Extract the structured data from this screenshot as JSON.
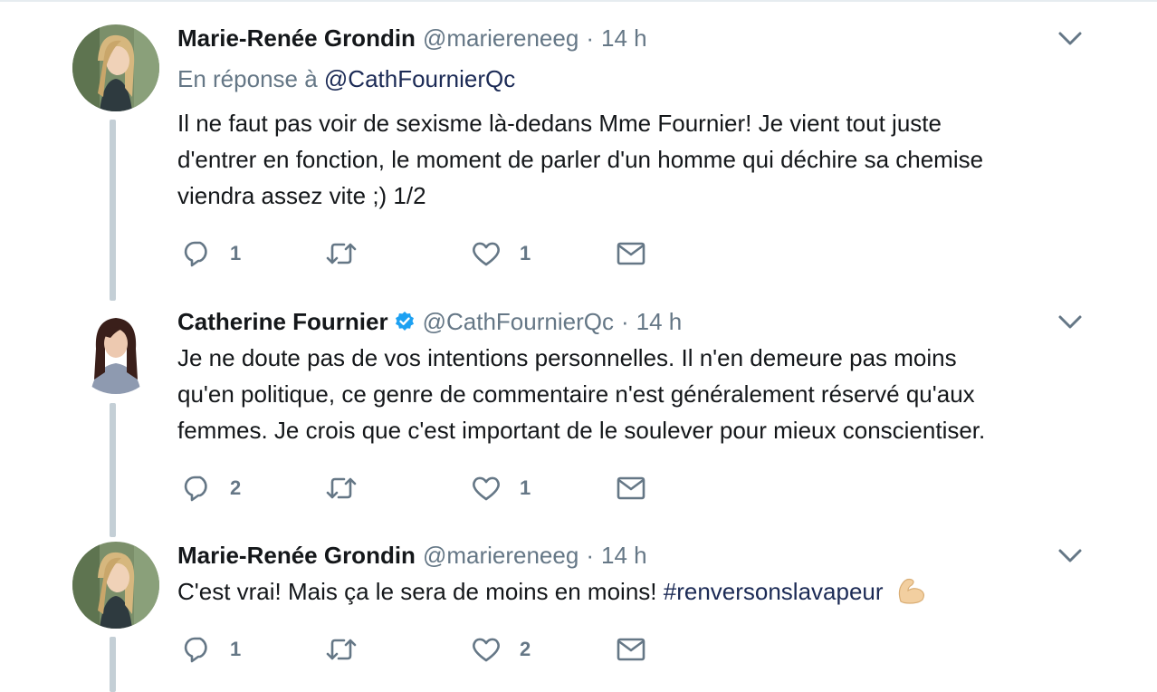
{
  "tweets": [
    {
      "name": "Marie-Renée Grondin",
      "handle": "@mariereneeg",
      "separator": "·",
      "time": "14 h",
      "reply_prefix": "En réponse à",
      "reply_handle": "@CathFournierQc",
      "lines": [
        "Il ne faut pas voir de sexisme là-dedans Mme Fournier! Je vient tout juste",
        "d'entrer en fonction, le moment de parler d'un homme qui déchire sa chemise",
        "viendra assez vite ;) 1/2"
      ],
      "reply_count": "1",
      "like_count": "1"
    },
    {
      "name": "Catherine Fournier",
      "verified": true,
      "handle": "@CathFournierQc",
      "separator": "·",
      "time": "14 h",
      "lines": [
        "Je ne doute pas de vos intentions personnelles. Il n'en demeure pas moins",
        "qu'en politique, ce genre de commentaire n'est généralement réservé qu'aux",
        "femmes. Je crois que c'est important de le soulever pour mieux conscientiser."
      ],
      "reply_count": "2",
      "like_count": "1"
    },
    {
      "name": "Marie-Renée Grondin",
      "handle": "@mariereneeg",
      "separator": "·",
      "time": "14 h",
      "text_before": "C'est vrai! Mais ça le sera de moins en moins!",
      "hashtag": "#renversonslavapeur",
      "emoji": "flexed-biceps",
      "reply_count": "1",
      "like_count": "2"
    }
  ],
  "colors": {
    "primary_text": "#14171a",
    "secondary_text": "#657786",
    "link": "#1b2a55",
    "verified": "#1da1f2",
    "thread_line": "#c4cfd6"
  },
  "icons": {
    "reply": "reply-icon",
    "retweet": "retweet-icon",
    "like": "heart-icon",
    "dm": "envelope-icon",
    "more": "chevron-down-icon",
    "verified": "verified-badge-icon"
  }
}
